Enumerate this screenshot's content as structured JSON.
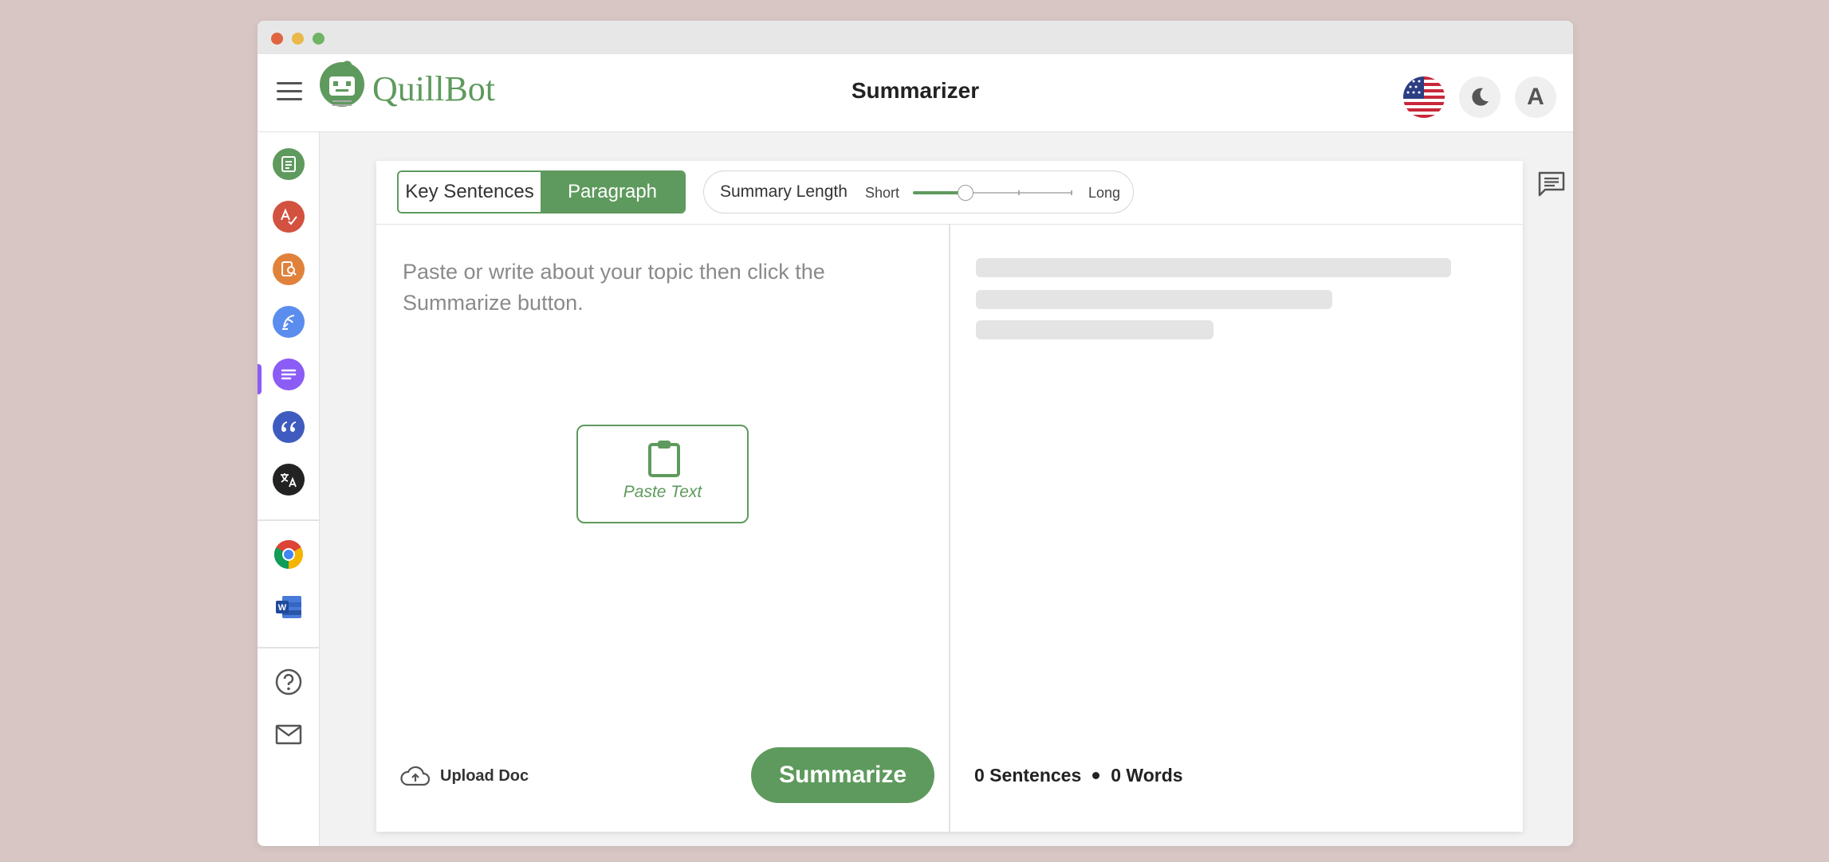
{
  "app": {
    "name": "QuillBot",
    "page_title": "Summarizer"
  },
  "header": {
    "language_flag": "us-flag-icon",
    "theme_icon": "moon-icon",
    "avatar_initial": "A"
  },
  "sidebar": {
    "items": [
      {
        "name": "paraphraser",
        "icon": "paraphraser-icon",
        "color": "#5e9a5d"
      },
      {
        "name": "grammar-checker",
        "icon": "grammar-check-icon",
        "color": "#d3513f"
      },
      {
        "name": "plagiarism-checker",
        "icon": "plagiarism-icon",
        "color": "#e0823c"
      },
      {
        "name": "co-writer",
        "icon": "quill-icon",
        "color": "#5b8def"
      },
      {
        "name": "summarizer",
        "icon": "summarizer-icon",
        "color": "#8b5cf6",
        "active": true
      },
      {
        "name": "citation-generator",
        "icon": "quote-icon",
        "color": "#3f5bbf"
      },
      {
        "name": "translator",
        "icon": "translate-icon",
        "color": "#222222"
      }
    ],
    "extensions": [
      {
        "name": "chrome-extension",
        "icon": "chrome-icon"
      },
      {
        "name": "word-addin",
        "icon": "word-icon"
      }
    ],
    "support": [
      {
        "name": "help",
        "icon": "help-icon"
      },
      {
        "name": "contact",
        "icon": "mail-icon"
      }
    ]
  },
  "modes": {
    "key_sentences": "Key Sentences",
    "paragraph": "Paragraph",
    "selected": "Paragraph"
  },
  "summary_length": {
    "label": "Summary Length",
    "min_label": "Short",
    "max_label": "Long",
    "value": 0.33
  },
  "input": {
    "placeholder": "Paste or write about your topic then click the Summarize button.",
    "paste_label": "Paste Text",
    "upload_label": "Upload Doc",
    "submit_label": "Summarize"
  },
  "output": {
    "sentences_count": "0 Sentences",
    "words_count": "0 Words"
  },
  "colors": {
    "brand": "#5e9a5d",
    "active_tool": "#8b5cf6",
    "background": "#d8c6c4"
  }
}
